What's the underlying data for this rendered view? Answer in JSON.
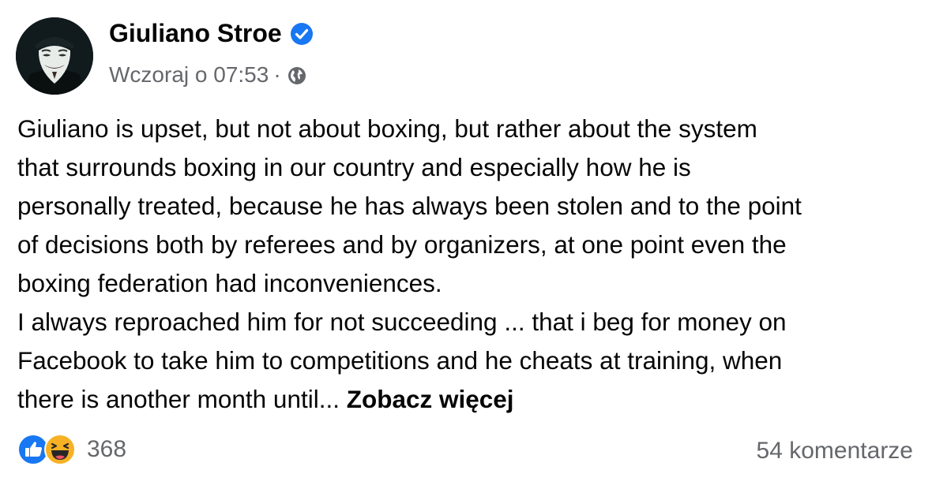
{
  "post": {
    "author_name": "Giuliano Stroe",
    "timestamp": "Wczoraj o 07:53",
    "separator": "·",
    "icons": {
      "avatar": "guy-fawkes-mask-avatar",
      "verified": "verified-badge-icon",
      "audience": "globe-icon"
    },
    "body_lines": [
      "Giuliano is upset, but not about boxing, but rather about the system",
      "that surrounds boxing in our country and especially how he is",
      "personally treated, because he has always been stolen and to the point",
      "of decisions both by referees and by  organizers, at one point even the",
      "boxing federation had inconveniences.",
      "I always reproached him for not succeeding ... that i beg for money on",
      "Facebook to take him to competitions and he cheats at training, when",
      "there is another month until... "
    ],
    "see_more": "Zobacz więcej"
  },
  "footer": {
    "reactions": [
      "like-icon",
      "haha-icon"
    ],
    "reaction_count": "368",
    "comments": "54 komentarze"
  },
  "colors": {
    "text": "#050505",
    "secondary": "#65676b",
    "brand_blue": "#1877f2",
    "haha_yellow": "#f7b125"
  }
}
